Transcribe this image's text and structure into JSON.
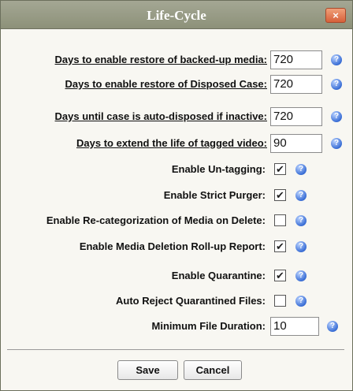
{
  "window": {
    "title": "Life-Cycle",
    "close_label": "×"
  },
  "fields": [
    {
      "label": "Days to enable restore of backed-up media:",
      "value": "720"
    },
    {
      "label": "Days to enable restore of Disposed Case:",
      "value": "720"
    },
    {
      "label": "Days until case is auto-disposed if inactive:",
      "value": "720"
    },
    {
      "label": "Days to extend the life of tagged video:",
      "value": "90"
    }
  ],
  "checkboxes": [
    {
      "label": "Enable Un-tagging:",
      "checked": true
    },
    {
      "label": "Enable Strict Purger:",
      "checked": true
    },
    {
      "label": "Enable Re-categorization of Media on Delete:",
      "checked": false
    },
    {
      "label": "Enable Media Deletion Roll-up Report:",
      "checked": true
    },
    {
      "label": "Enable Quarantine:",
      "checked": true
    },
    {
      "label": "Auto Reject Quarantined Files:",
      "checked": false
    }
  ],
  "min_duration": {
    "label": "Minimum File Duration:",
    "value": "10"
  },
  "help_glyph": "?",
  "check_glyph": "✔",
  "buttons": {
    "save_label": "Save",
    "cancel_label": "Cancel"
  }
}
